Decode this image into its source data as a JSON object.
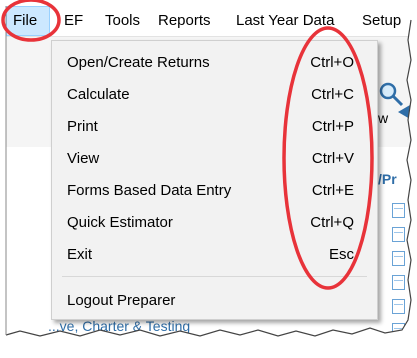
{
  "menubar": {
    "items": [
      "File",
      "EF",
      "Tools",
      "Reports",
      "Last Year Data",
      "Setup"
    ]
  },
  "toolbar": {
    "partial_label": "w"
  },
  "side_panel": {
    "heading_partial": "/Pr"
  },
  "bottom_link": "...ve, Charter & Testing",
  "file_menu": {
    "items": [
      {
        "label": "Open/Create Returns",
        "shortcut": "Ctrl+O"
      },
      {
        "label": "Calculate",
        "shortcut": "Ctrl+C"
      },
      {
        "label": "Print",
        "shortcut": "Ctrl+P"
      },
      {
        "label": "View",
        "shortcut": "Ctrl+V"
      },
      {
        "label": "Forms Based Data Entry",
        "shortcut": "Ctrl+E"
      },
      {
        "label": "Quick Estimator",
        "shortcut": "Ctrl+Q"
      },
      {
        "label": "Exit",
        "shortcut": "Esc"
      }
    ],
    "footer_item": {
      "label": "Logout Preparer"
    }
  },
  "colors": {
    "annotation": "#e8333a",
    "menu_highlight": "#cce8ff",
    "link_blue": "#2f6ea8"
  }
}
